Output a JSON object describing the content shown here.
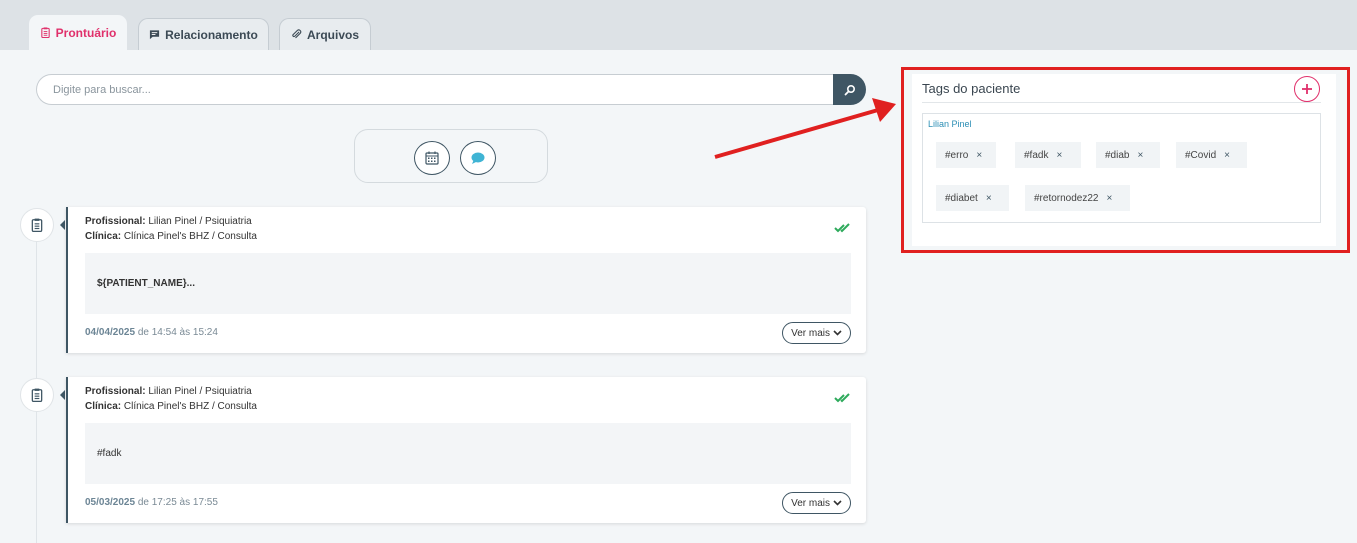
{
  "tabs": [
    {
      "label": "Prontuário",
      "active": true
    },
    {
      "label": "Relacionamento",
      "active": false
    },
    {
      "label": "Arquivos",
      "active": false
    }
  ],
  "search": {
    "placeholder": "Digite para buscar..."
  },
  "records": [
    {
      "profissional_label": "Profissional:",
      "profissional": "Lilian Pinel / Psiquiatria",
      "clinica_label": "Clínica:",
      "clinica": "Clínica Pinel's BHZ / Consulta",
      "note": "${PATIENT_NAME}...",
      "date": "04/04/2025",
      "time": "de 14:54 às 15:24",
      "more_label": "Ver mais"
    },
    {
      "profissional_label": "Profissional:",
      "profissional": "Lilian Pinel / Psiquiatria",
      "clinica_label": "Clínica:",
      "clinica": "Clínica Pinel's BHZ / Consulta",
      "note": "#fadk",
      "date": "05/03/2025",
      "time": "de 17:25 às 17:55",
      "more_label": "Ver mais"
    }
  ],
  "tags_panel": {
    "title": "Tags do paciente",
    "owner": "Lilian Pinel",
    "tags": [
      "#erro",
      "#fadk",
      "#diab",
      "#Covid",
      "#diabet",
      "#retornodez22"
    ],
    "remove_symbol": "×"
  },
  "colors": {
    "accent": "#e0306b",
    "primary": "#3f5664",
    "success": "#2eaa5c",
    "highlight": "#e02020",
    "chat": "#3fb4d4"
  },
  "icons": {
    "search": "search-icon",
    "calendar": "calendar-icon",
    "chat": "chat-bubble-icon",
    "clipboard": "clipboard-icon",
    "check": "double-check-icon",
    "add": "plus-icon"
  }
}
